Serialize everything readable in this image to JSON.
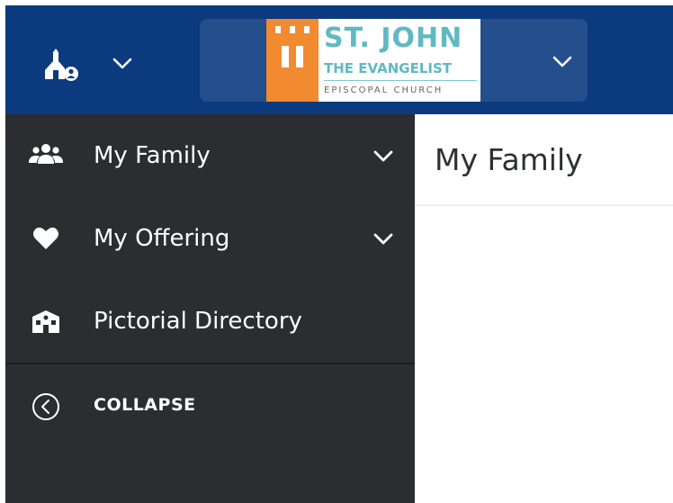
{
  "header": {
    "home_icon": "church-user-icon",
    "home_dropdown_icon": "chevron-down-icon",
    "org": {
      "logo_line1": "ST. JOHN",
      "logo_line2": "THE EVANGELIST",
      "logo_line3": "EPISCOPAL CHURCH",
      "dropdown_icon": "chevron-down-icon"
    }
  },
  "sidebar": {
    "items": [
      {
        "label": "My Family",
        "icon": "users-icon",
        "expandable": true
      },
      {
        "label": "My Offering",
        "icon": "heart-icon",
        "expandable": true
      },
      {
        "label": "Pictorial Directory",
        "icon": "school-building-icon",
        "expandable": false
      }
    ],
    "collapse_label": "COLLAPSE",
    "collapse_icon": "chevron-left-circle-icon"
  },
  "main": {
    "title": "My Family"
  },
  "colors": {
    "header_bg": "#0c3a7f",
    "sidebar_bg": "#2b2d30",
    "logo_teal": "#5fb9c3",
    "logo_orange": "#f28a30"
  }
}
